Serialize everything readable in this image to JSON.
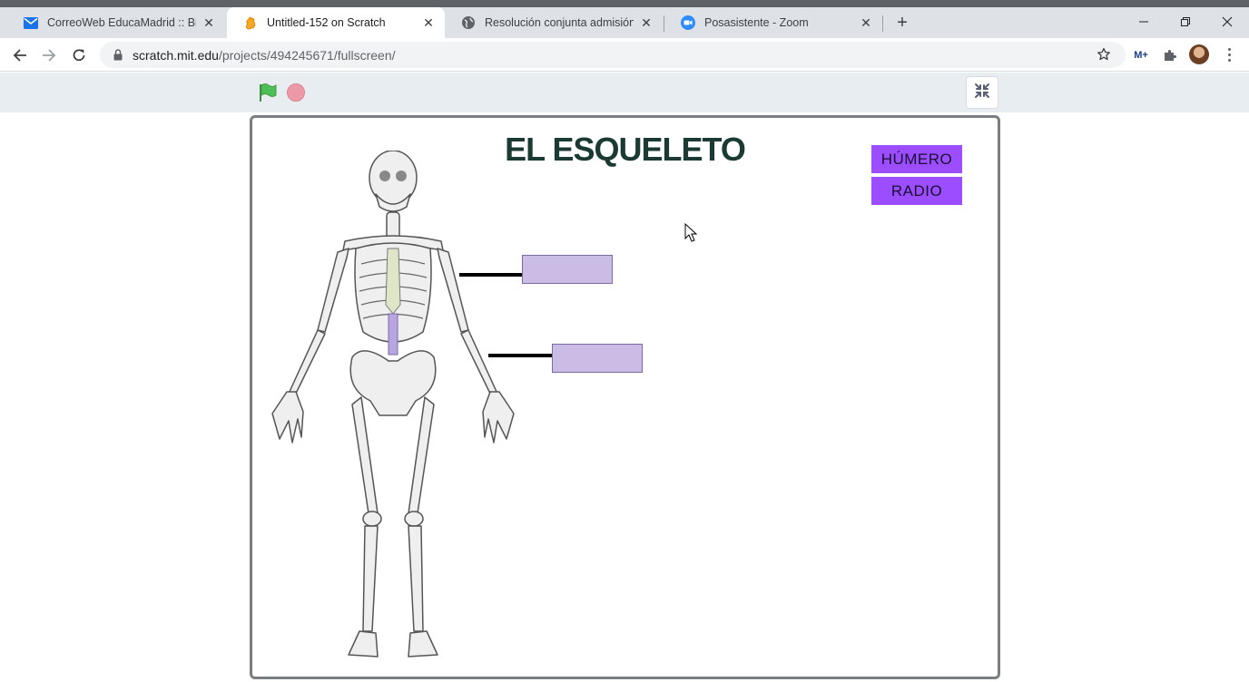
{
  "browser": {
    "tabs": [
      {
        "title": "CorreoWeb EducaMadrid :: Bienv",
        "icon": "mail-icon",
        "active": false
      },
      {
        "title": "Untitled-152 on Scratch",
        "icon": "scratch-icon",
        "active": true
      },
      {
        "title": "Resolución conjunta admisión ré",
        "icon": "globe-icon",
        "active": false
      },
      {
        "title": "Posasistente - Zoom",
        "icon": "zoom-icon",
        "active": false
      }
    ],
    "new_tab": "+",
    "url_host": "scratch.mit.edu",
    "url_path": "/projects/494245671/fullscreen/",
    "extension_label": "M+"
  },
  "stage": {
    "title": "EL ESQUELETO",
    "options": [
      {
        "label": "HÚMERO"
      },
      {
        "label": "RADIO"
      }
    ]
  },
  "colors": {
    "option_bg": "#9b4dff",
    "slot_bg": "#cbbce6",
    "title": "#1c3a34",
    "flag": "#4cbf56",
    "stop": "#ec9aa8"
  }
}
